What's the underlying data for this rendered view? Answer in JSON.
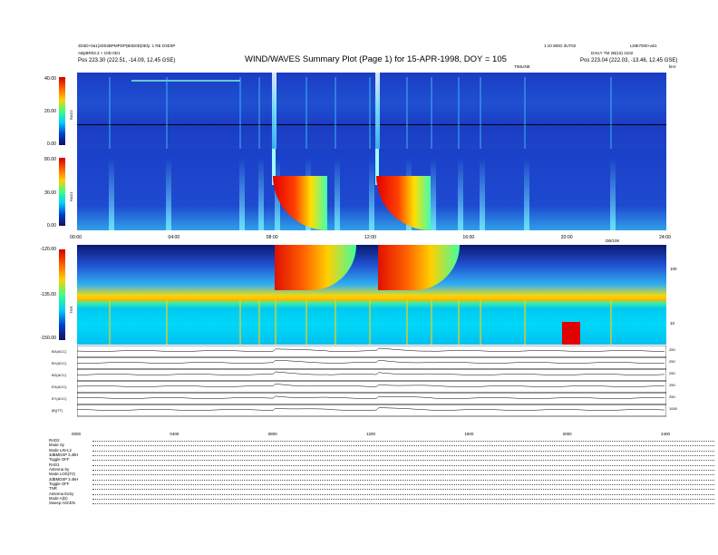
{
  "header": {
    "title": "WIND/WAVES Summary Plot (Page 1) for 15-APR-1998, DOY = 105",
    "left_line1": "3D3D+0a1(2D03BPMPDP(B0D0D)0Ely: 1 RE D3D3P",
    "left_line2": "ABpBR03.3 + 10D.0D1",
    "left_line3": "Pos    223.30 (222.51, -14.09, 12.45 GSE)",
    "right_top_mid": "1:10 WED 3UT02",
    "right_top": "LD8I7000+a01",
    "right_line2": "DAILY TM 2B(15) 3102",
    "right_line3": "Pos    223.04 (222.03, -13.46, 12.45 GSE)",
    "freq_unit_top": "kHz",
    "timeline_label": "TIMLINE"
  },
  "panels": {
    "rad2": {
      "label": "RAD2",
      "ticks": [
        "40.00",
        "20.00",
        "0.00"
      ]
    },
    "rad1": {
      "label": "RAD1",
      "ticks": [
        "80.00",
        "30.00",
        "0.00"
      ]
    },
    "tnr": {
      "label": "TNR",
      "ticks": [
        "-120.00",
        "-135.00",
        "-150.00"
      ],
      "right_ticks": [
        "100",
        "10"
      ],
      "right_unit": "MHz",
      "corner_label": "DB/10K"
    }
  },
  "time_axis": {
    "labels": [
      "00:00",
      "04:00",
      "08:00",
      "12:00",
      "16:00",
      "20:00",
      "24:00"
    ],
    "bottom_labels": [
      "0000",
      "0400",
      "0800",
      "1200",
      "1600",
      "2000",
      "2400"
    ]
  },
  "line_plots": [
    {
      "label": "BX(ACC)",
      "scale": "250"
    },
    {
      "label": "BY(ACC)",
      "scale": "250"
    },
    {
      "label": "BZ(ACC)",
      "scale": "250"
    },
    {
      "label": "EX(ACC)",
      "scale": "250"
    },
    {
      "label": "EY(ACC)",
      "scale": "250"
    },
    {
      "label": "|B|(TT)",
      "scale": "1000"
    }
  ],
  "parameters": [
    "RAD2",
    "Mode    Sy",
    "Mode    LIN-L2",
    "3dBMDSP 3.4kH",
    "Toggle   OFF",
    "RAD1",
    "Antenna   Sy",
    "Mode   LOG(F2)",
    "3dBMDSP 3.4kH",
    "Toggle   OFF",
    "TNR",
    "Antenna   ExSy",
    "Mode   A(D)",
    "Sweep   ASCEN"
  ],
  "chart_data": {
    "type": "heatmap",
    "title": "WIND/WAVES Summary Plot (Page 1) for 15-APR-1998, DOY = 105",
    "x": [
      "00:00",
      "04:00",
      "08:00",
      "12:00",
      "16:00",
      "20:00",
      "24:00"
    ],
    "xlim": [
      0,
      24
    ],
    "panels": [
      {
        "name": "RAD2",
        "ylim": [
          0,
          40
        ],
        "yticks": [
          40,
          20,
          0
        ]
      },
      {
        "name": "RAD1",
        "ylim": [
          0,
          80
        ],
        "yticks": [
          80,
          30,
          0
        ]
      },
      {
        "name": "TNR",
        "ylim": [
          -150,
          -120
        ],
        "yticks": [
          -120,
          -135,
          -150
        ],
        "freq_ticks": [
          100,
          10
        ]
      }
    ],
    "events_hours": [
      1.3,
      3.6,
      6.6,
      7.4,
      8.05,
      9.3,
      10.5,
      11.9,
      13.4,
      14.4,
      15.5,
      16.4,
      18.2,
      21.7
    ],
    "major_bursts_hours": [
      8.05,
      12.25
    ],
    "colors": {
      "low": "#1030b0",
      "mid": "#00e0ff",
      "high": "#ffff00",
      "max": "#ff0000"
    }
  }
}
